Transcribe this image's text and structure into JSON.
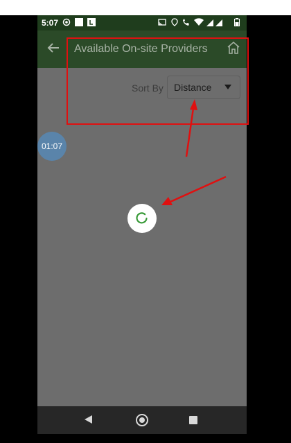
{
  "status_bar": {
    "time": "5:07"
  },
  "app_bar": {
    "title": "Available On-site Providers",
    "back_icon": "arrow-left-icon",
    "home_icon": "home-icon"
  },
  "sort": {
    "label": "Sort By",
    "selected": "Distance"
  },
  "timer": {
    "value": "01:07"
  },
  "loading": {
    "icon": "loading-spinner-icon"
  },
  "nav_bar": {
    "back_icon": "nav-back-icon",
    "home_icon": "nav-home-icon",
    "recent_icon": "nav-recents-icon"
  },
  "colors": {
    "app_bar": "#2b4a28",
    "overlay": "#6d6d6d",
    "annotation": "#e01010",
    "spinner": "#3a9b3a",
    "timer": "#5a84aa"
  }
}
